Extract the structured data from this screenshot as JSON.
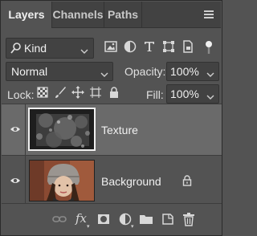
{
  "tabs": [
    {
      "label": "Layers",
      "active": true
    },
    {
      "label": "Channels",
      "active": false
    },
    {
      "label": "Paths",
      "active": false
    }
  ],
  "menu_icon": "hamburger-menu-icon",
  "filter": {
    "kind_label": "Kind",
    "icons": [
      "pixel-filter-icon",
      "adjustment-filter-icon",
      "type-filter-icon",
      "shape-filter-icon",
      "smart-object-filter-icon",
      "filter-toggle-icon"
    ]
  },
  "blend": {
    "mode": "Normal",
    "opacity_label": "Opacity:",
    "opacity_value": "100%"
  },
  "lock": {
    "label": "Lock:",
    "icons": [
      "lock-transparent-pixels-icon",
      "lock-image-pixels-icon",
      "lock-position-icon",
      "lock-artboard-icon",
      "lock-all-icon"
    ],
    "fill_label": "Fill:",
    "fill_value": "100%"
  },
  "layers": [
    {
      "name": "Texture",
      "visible": true,
      "selected": true,
      "locked": false
    },
    {
      "name": "Background",
      "visible": true,
      "selected": false,
      "locked": true
    }
  ],
  "bottom_icons": [
    "link-layers-icon",
    "fx-icon",
    "add-mask-icon",
    "adjustment-layer-icon",
    "new-group-icon",
    "new-layer-icon",
    "delete-layer-icon"
  ],
  "bottom_fx": "fx",
  "colors": {
    "panel": "#535353",
    "tabbar": "#424242",
    "selected_row": "#6a6a6a"
  }
}
